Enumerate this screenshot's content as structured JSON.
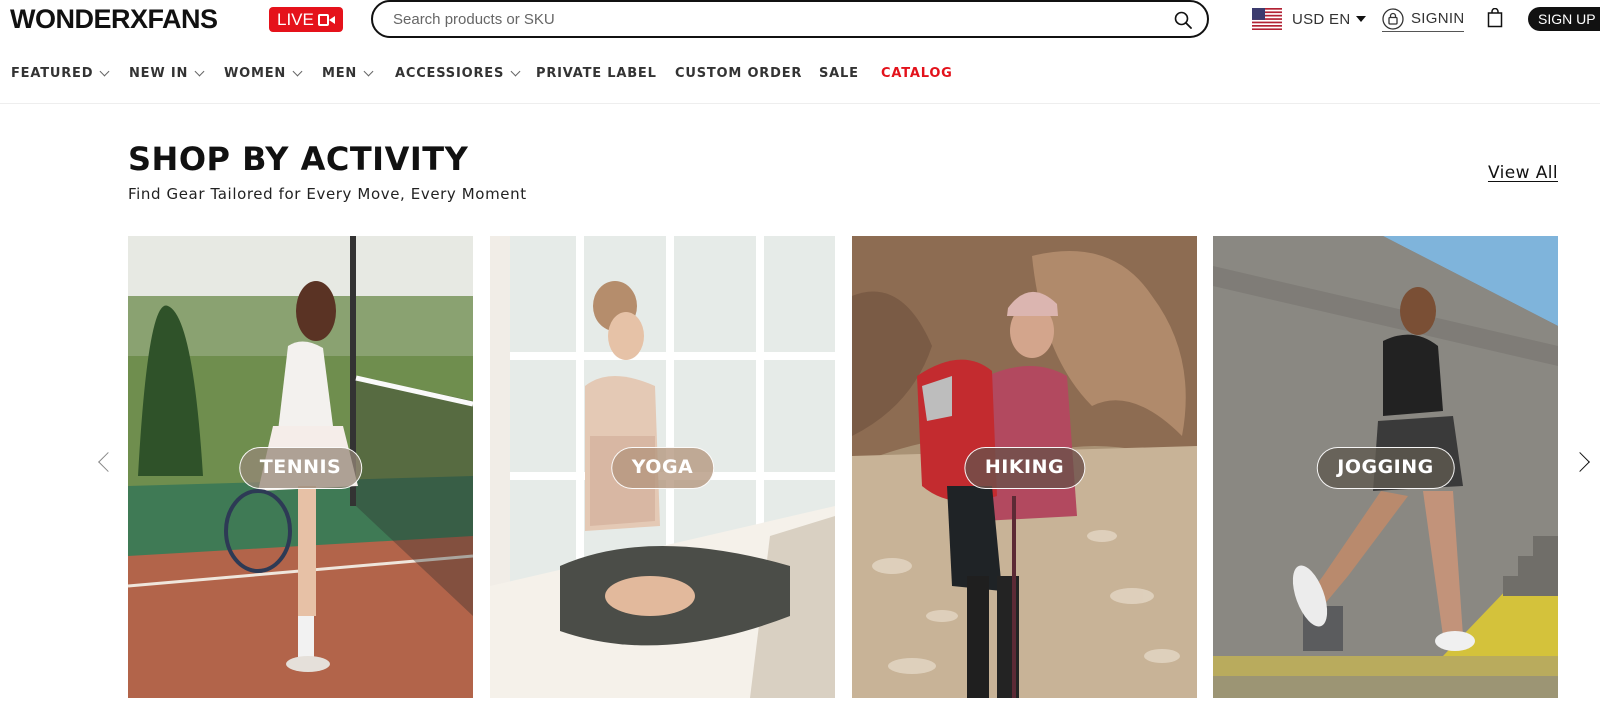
{
  "header": {
    "logo": "WONDERXFANS",
    "live_label": "LIVE",
    "search_placeholder": "Search products or SKU",
    "currency_label": "USD EN",
    "signin_label": "SIGNIN",
    "signup_label": "SIGN UP"
  },
  "nav": {
    "items": [
      {
        "label": "FEATURED",
        "dropdown": true
      },
      {
        "label": "NEW IN",
        "dropdown": true
      },
      {
        "label": "WOMEN",
        "dropdown": true
      },
      {
        "label": "MEN",
        "dropdown": true
      },
      {
        "label": "ACCESSIORES",
        "dropdown": true
      },
      {
        "label": "PRIVATE LABEL",
        "dropdown": false
      },
      {
        "label": "CUSTOM ORDER",
        "dropdown": false
      },
      {
        "label": "SALE",
        "dropdown": false
      },
      {
        "label": "CATALOG",
        "dropdown": false,
        "color": "#e3121b"
      }
    ]
  },
  "section": {
    "title": "SHOP BY ACTIVITY",
    "subtitle": "Find Gear Tailored for Every Move, Every Moment",
    "view_all": "View All"
  },
  "cards": [
    {
      "label": "TENNIS",
      "icon": "tennis-photo"
    },
    {
      "label": "YOGA",
      "icon": "yoga-photo"
    },
    {
      "label": "HIKING",
      "icon": "hiking-photo"
    },
    {
      "label": "JOGGING",
      "icon": "jogging-photo"
    }
  ],
  "colors": {
    "brand_red": "#e5121b",
    "catalog_red": "#e3121b",
    "text_dark": "#111111"
  }
}
